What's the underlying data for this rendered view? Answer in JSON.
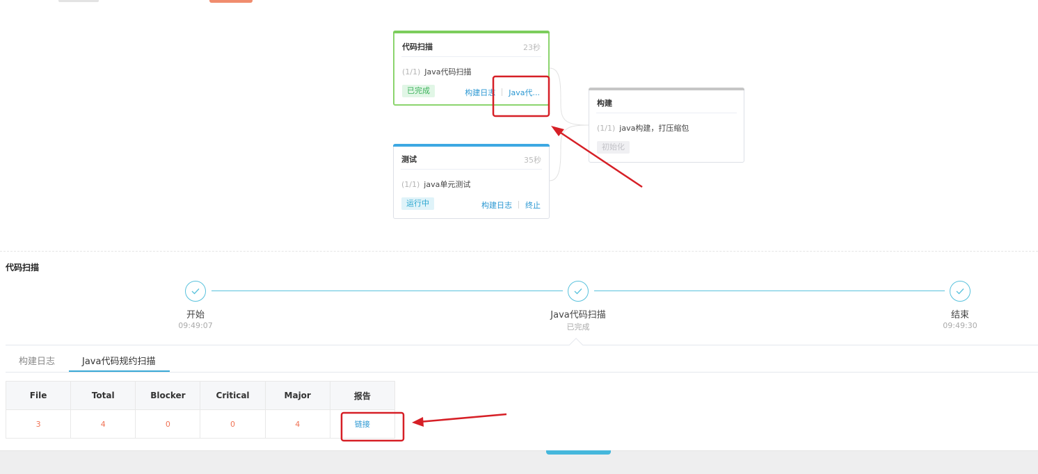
{
  "stages": {
    "scan": {
      "title": "代码扫描",
      "time": "23秒",
      "step_index": "(1/1)",
      "step_name": "Java代码扫描",
      "status": "已完成",
      "link_log": "构建日志",
      "link_report": "Java代..."
    },
    "build": {
      "title": "构建",
      "step_index": "(1/1)",
      "step_name": "java构建，打压缩包",
      "status": "初始化"
    },
    "test": {
      "title": "测试",
      "time": "35秒",
      "step_index": "(1/1)",
      "step_name": "java单元测试",
      "status": "运行中",
      "link_log": "构建日志",
      "link_stop": "终止"
    }
  },
  "detail": {
    "title": "代码扫描",
    "timeline": [
      {
        "label": "开始",
        "sub": "09:49:07"
      },
      {
        "label": "Java代码扫描",
        "sub": "已完成"
      },
      {
        "label": "结束",
        "sub": "09:49:30"
      }
    ],
    "tabs": [
      "构建日志",
      "Java代码规约扫描"
    ],
    "table": {
      "headers": [
        "File",
        "Total",
        "Blocker",
        "Critical",
        "Major",
        "报告"
      ],
      "row": [
        "3",
        "4",
        "0",
        "0",
        "4"
      ],
      "report_link": "链接"
    }
  },
  "colors": {
    "accent": "#3aa9d6",
    "success": "#7ccd5c",
    "running": "#3da8e2",
    "value_red": "#f07254",
    "annotation_red": "#d61f26"
  }
}
